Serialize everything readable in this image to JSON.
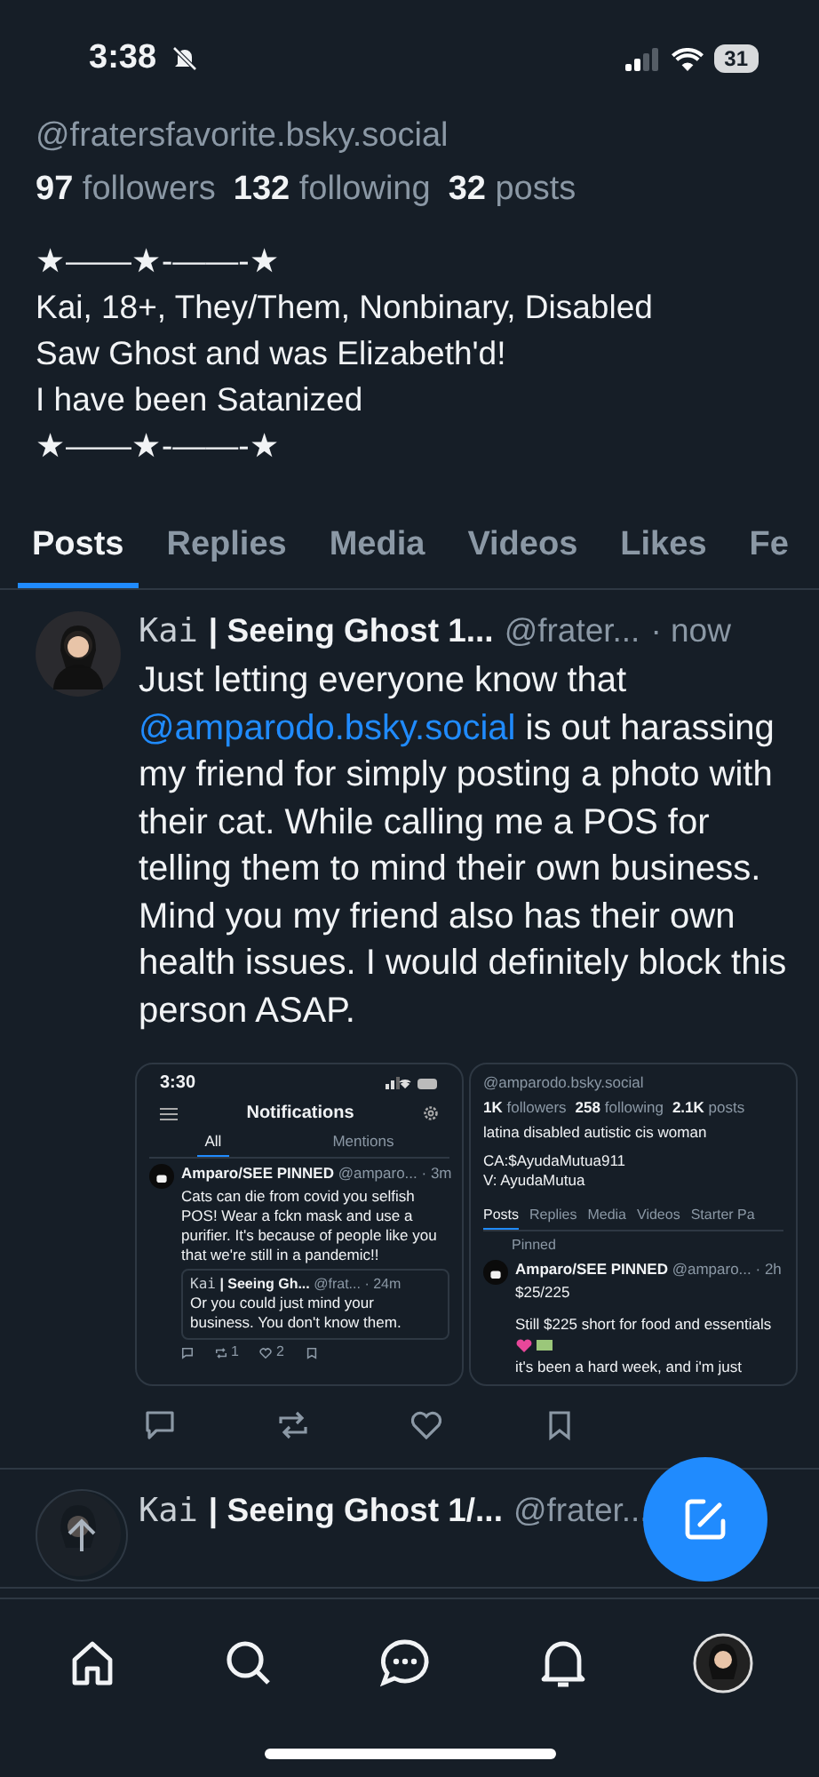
{
  "status_bar": {
    "time": "3:38",
    "battery": "31"
  },
  "profile": {
    "handle": "@fratersfavorite.bsky.social",
    "stats": [
      {
        "count": "97",
        "label": "followers"
      },
      {
        "count": "132",
        "label": "following"
      },
      {
        "count": "32",
        "label": "posts"
      }
    ],
    "bio": [
      "★——★-——-★",
      "Kai, 18+, They/Them, Nonbinary, Disabled",
      "Saw Ghost and was Elizabeth'd!",
      "I have been Satanized",
      "★——★-——-★"
    ]
  },
  "tabs": [
    {
      "label": "Posts",
      "selected": true
    },
    {
      "label": "Replies",
      "selected": false
    },
    {
      "label": "Media",
      "selected": false
    },
    {
      "label": "Videos",
      "selected": false
    },
    {
      "label": "Likes",
      "selected": false
    },
    {
      "label": "Fe",
      "selected": false
    }
  ],
  "posts": [
    {
      "name_prefix": "Kai",
      "name": "| Seeing Ghost 1...",
      "handle": "@frater...",
      "time": "· now",
      "text": [
        {
          "kind": "plain",
          "text": "Just letting everyone know that "
        },
        {
          "kind": "link",
          "text": "@amparodo.bsky.social"
        },
        {
          "kind": "plain",
          "text": " is out harassing my friend for simply posting a photo with their cat. While calling me a POS for telling them to mind their own business. Mind you my friend also has their own health issues. I would definitely block this person ASAP."
        }
      ],
      "images": [
        {
          "kind": "notifications",
          "time": "3:30",
          "title": "Notifications",
          "tabs": [
            {
              "label": "All",
              "selected": true
            },
            {
              "label": "Mentions",
              "selected": false
            }
          ],
          "author": "Amparo/SEE PINNED",
          "handle": "@amparo...",
          "age": "· 3m",
          "text": "Cats can die from covid you selfish POS! Wear a fckn mask and use a purifier. It's because of people like you that we're still in a pandemic!!",
          "quote": {
            "name_prefix": "Kai",
            "name": "| Seeing Gh...",
            "handle": "@frat...",
            "age": "· 24m",
            "text": "Or you could just mind your business. You don't know them."
          },
          "counts": {
            "reposts": "1",
            "likes": "2"
          }
        },
        {
          "kind": "profile",
          "handle": "@amparodo.bsky.social",
          "stats": [
            {
              "count": "1K",
              "label": "followers"
            },
            {
              "count": "258",
              "label": "following"
            },
            {
              "count": "2.1K",
              "label": "posts"
            }
          ],
          "bio": [
            "latina disabled autistic cis woman",
            "CA:$AyudaMutua911",
            "V: AyudaMutua"
          ],
          "tabs": [
            {
              "label": "Posts",
              "selected": true
            },
            {
              "label": "Replies",
              "selected": false
            },
            {
              "label": "Media",
              "selected": false
            },
            {
              "label": "Videos",
              "selected": false
            },
            {
              "label": "Starter Pa",
              "selected": false
            }
          ],
          "pinned": "Pinned",
          "author": "Amparo/SEE PINNED",
          "handle2": "@amparo...",
          "age": "· 2h",
          "lines": [
            "$25/225",
            "Still $225 short for food and essentials"
          ],
          "last": "it's been a hard week, and i'm just"
        }
      ]
    },
    {
      "name_prefix": "Kai",
      "name": "| Seeing Ghost 1/...",
      "handle": "@frater..."
    }
  ]
}
